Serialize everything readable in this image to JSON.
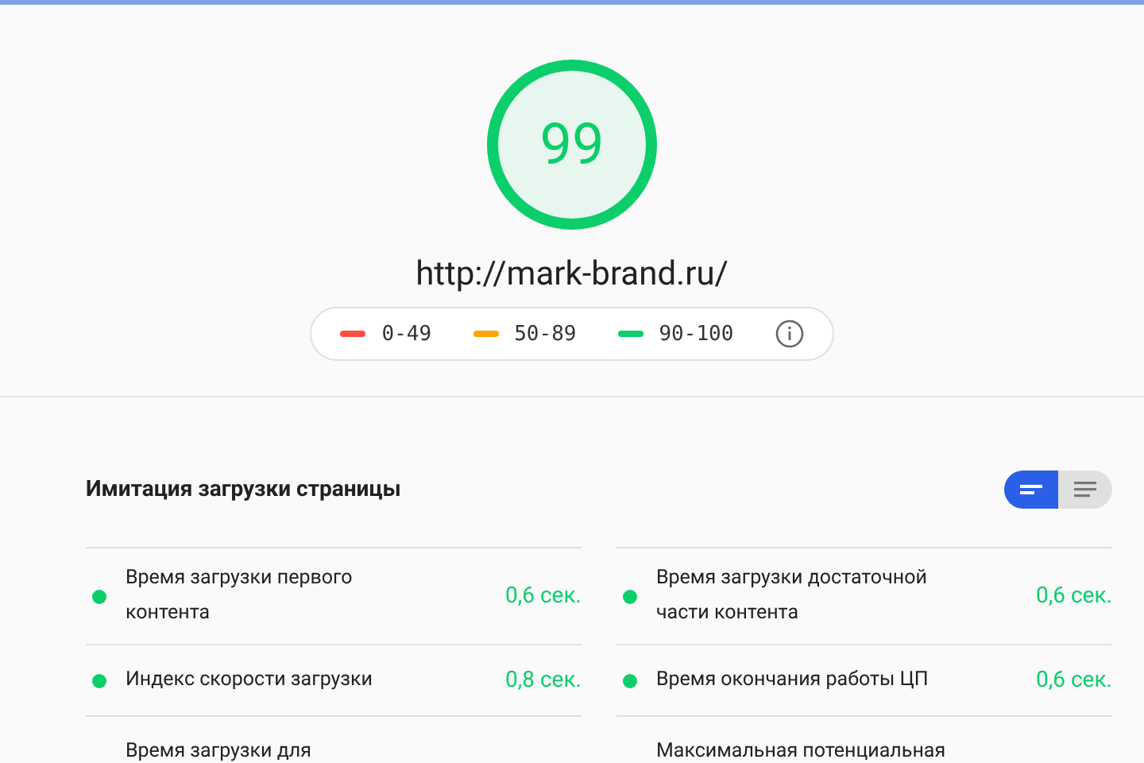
{
  "score": {
    "value": "99",
    "color": "#0cce6b"
  },
  "url": "http://mark-brand.ru/",
  "legend": [
    {
      "range": "0-49",
      "color": "#ff4e42"
    },
    {
      "range": "50-89",
      "color": "#ffa400"
    },
    {
      "range": "90-100",
      "color": "#0cce6b"
    }
  ],
  "section": {
    "title": "Имитация загрузки страницы",
    "view_toggle": [
      {
        "kind": "compact",
        "selected": true
      },
      {
        "kind": "list",
        "selected": false
      }
    ]
  },
  "metrics": [
    {
      "label": "Время загрузки первого контента",
      "value": "0,6 сек.",
      "color": "#0cce6b"
    },
    {
      "label": "Время загрузки достаточной части контента",
      "value": "0,6 сек.",
      "color": "#0cce6b"
    },
    {
      "label": "Индекс скорости загрузки",
      "value": "0,8 сек.",
      "color": "#0cce6b"
    },
    {
      "label": "Время окончания работы ЦП",
      "value": "0,6 сек.",
      "color": "#0cce6b"
    },
    {
      "label": "Время загрузки для"
    },
    {
      "label": "Максимальная потенциальная"
    }
  ]
}
